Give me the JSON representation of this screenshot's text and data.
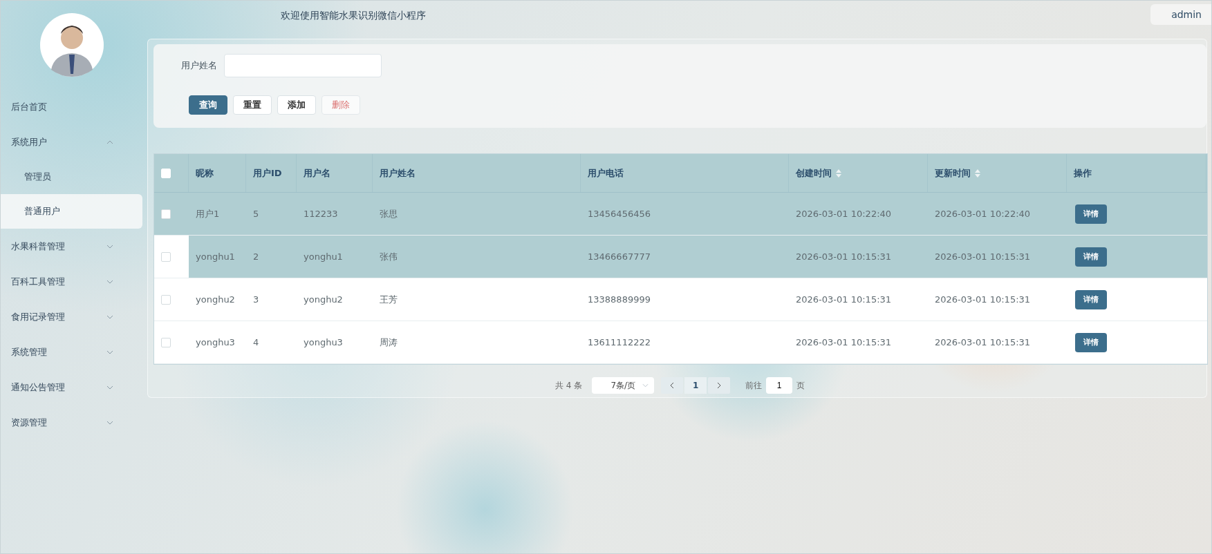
{
  "header": {
    "title": "欢迎使用智能水果识别微信小程序",
    "user": "admin"
  },
  "sidebar": {
    "items": [
      {
        "label": "后台首页",
        "kind": "link",
        "selected": false
      },
      {
        "label": "系统用户",
        "kind": "group",
        "expanded": true,
        "children": [
          {
            "label": "管理员",
            "selected": false
          },
          {
            "label": "普通用户",
            "selected": true
          }
        ]
      },
      {
        "label": "水果科普管理",
        "kind": "group",
        "expanded": false
      },
      {
        "label": "百科工具管理",
        "kind": "group",
        "expanded": false
      },
      {
        "label": "食用记录管理",
        "kind": "group",
        "expanded": false
      },
      {
        "label": "系统管理",
        "kind": "group",
        "expanded": false
      },
      {
        "label": "通知公告管理",
        "kind": "group",
        "expanded": false
      },
      {
        "label": "资源管理",
        "kind": "group",
        "expanded": false
      }
    ]
  },
  "search": {
    "label": "用户姓名",
    "buttons": [
      {
        "label": "查询",
        "kind": "primary",
        "disabled": false
      },
      {
        "label": "重置",
        "kind": "plain",
        "disabled": false
      },
      {
        "label": "添加",
        "kind": "plain",
        "disabled": false
      },
      {
        "label": "删除",
        "kind": "danger",
        "disabled": true
      }
    ]
  },
  "table": {
    "select_all_checked": false,
    "columns": [
      {
        "label": "昵称",
        "sortable": false
      },
      {
        "label": "用户ID",
        "sortable": false
      },
      {
        "label": "用户名",
        "sortable": false
      },
      {
        "label": "用户姓名",
        "sortable": false
      },
      {
        "label": "用户电话",
        "sortable": false
      },
      {
        "label": "创建时间",
        "sortable": true
      },
      {
        "label": "更新时间",
        "sortable": true
      },
      {
        "label": "操作",
        "sortable": false
      }
    ],
    "rows": [
      {
        "cells": [
          "用户1",
          "5",
          "112233",
          "张思",
          "13456456456",
          "2026-03-01 10:22:40",
          "2026-03-01 10:22:40"
        ],
        "action": "详情",
        "highlighted": true
      },
      {
        "cells": [
          "yonghu1",
          "2",
          "yonghu1",
          "张伟",
          "13466667777",
          "2026-03-01 10:15:31",
          "2026-03-01 10:15:31"
        ],
        "action": "详情",
        "highlighted": true
      },
      {
        "cells": [
          "yonghu2",
          "3",
          "yonghu2",
          "王芳",
          "13388889999",
          "2026-03-01 10:15:31",
          "2026-03-01 10:15:31"
        ],
        "action": "详情",
        "highlighted": false
      },
      {
        "cells": [
          "yonghu3",
          "4",
          "yonghu3",
          "周涛",
          "13611112222",
          "2026-03-01 10:15:31",
          "2026-03-01 10:15:31"
        ],
        "action": "详情",
        "highlighted": false
      }
    ]
  },
  "pagination": {
    "total": "共 4 条",
    "page_size": "7条/页",
    "pages": [
      {
        "label": "1",
        "selected": true
      }
    ],
    "goto_label": "前往",
    "goto_value": "1",
    "page_unit": "页"
  }
}
